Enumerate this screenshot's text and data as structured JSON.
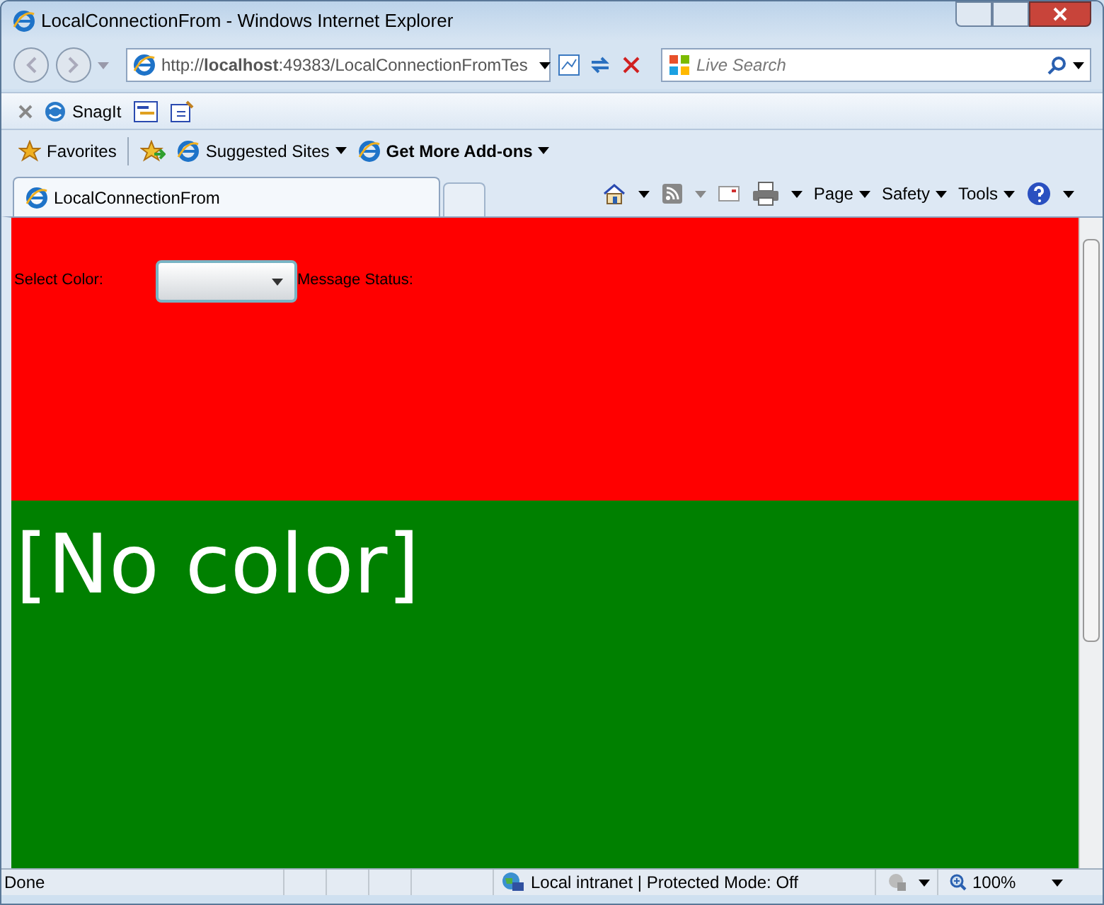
{
  "window": {
    "title": "LocalConnectionFrom - Windows Internet Explorer"
  },
  "address_bar": {
    "value": "http://**localhost**:49383/LocalConnectionFromTes"
  },
  "search": {
    "placeholder": "Live Search"
  },
  "toolbar": {
    "items": [
      "SnagIt"
    ]
  },
  "favorites_bar": {
    "items": [
      {
        "label": "Favorites",
        "bold": false,
        "dropdown": false
      },
      {
        "label": "Suggested Sites",
        "bold": false,
        "dropdown": true
      },
      {
        "label": "Get More Add-ons",
        "bold": true,
        "dropdown": true
      }
    ]
  },
  "tabs": [
    {
      "label": "LocalConnectionFrom",
      "selected": true
    }
  ],
  "command_bar": {
    "items": [
      "Page",
      "Safety",
      "Tools"
    ]
  },
  "page": {
    "top_panel": {
      "select_label": "Select Color:",
      "status_label": "Message Status:"
    },
    "bottom_panel": {
      "text": "[No color]"
    }
  },
  "status_bar": {
    "text": "Done",
    "zone": "Local intranet | Protected Mode: Off",
    "zoom": "100%"
  }
}
